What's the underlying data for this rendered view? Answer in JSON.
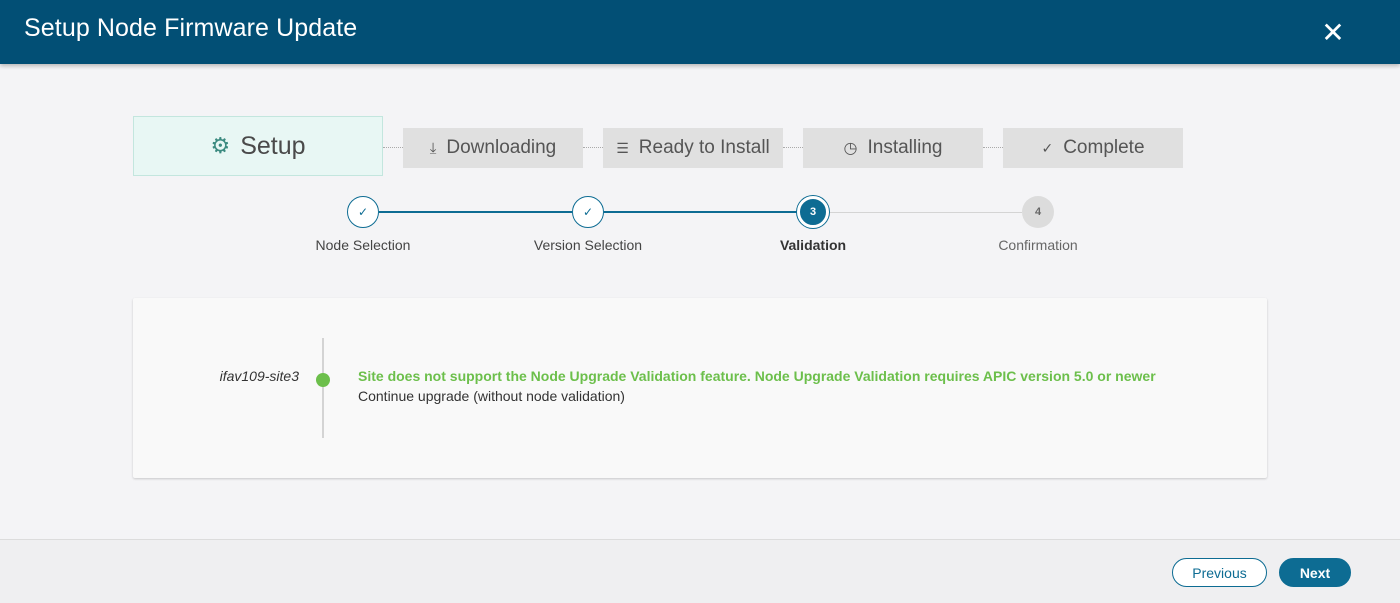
{
  "header": {
    "title": "Setup Node Firmware Update",
    "close_icon": "close-icon",
    "close_glyph": "✕"
  },
  "stages": [
    {
      "label": "Setup",
      "icon": "gear-icon",
      "glyph": "⚙",
      "active": true
    },
    {
      "label": "Downloading",
      "icon": "download-icon",
      "glyph": "⤓",
      "active": false
    },
    {
      "label": "Ready to Install",
      "icon": "checklist-icon",
      "glyph": "☰",
      "active": false
    },
    {
      "label": "Installing",
      "icon": "clock-icon",
      "glyph": "◷",
      "active": false
    },
    {
      "label": "Complete",
      "icon": "check-circle-icon",
      "glyph": "✓",
      "active": false
    }
  ],
  "wizard_steps": [
    {
      "label": "Node Selection",
      "status": "done",
      "marker": "✓"
    },
    {
      "label": "Version Selection",
      "status": "done",
      "marker": "✓"
    },
    {
      "label": "Validation",
      "status": "current",
      "marker": "3"
    },
    {
      "label": "Confirmation",
      "status": "todo",
      "marker": "4"
    }
  ],
  "validation": {
    "site": "ifav109-site3",
    "status_color": "#6cbf4b",
    "message": "Site does not support the Node Upgrade Validation feature. Node Upgrade Validation requires APIC version 5.0 or newer",
    "detail": "Continue upgrade (without node validation)"
  },
  "footer": {
    "previous_label": "Previous",
    "next_label": "Next"
  },
  "colors": {
    "header_bg": "#024f75",
    "accent": "#0d6c93",
    "success": "#6cbf4b",
    "active_stage_bg": "#e8f7f4"
  }
}
